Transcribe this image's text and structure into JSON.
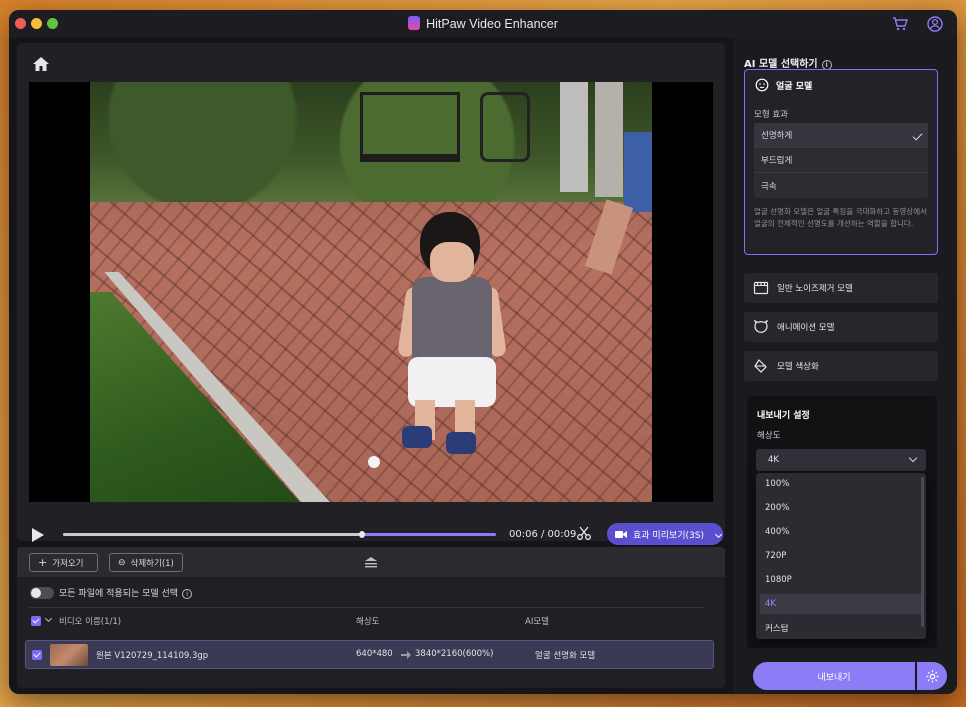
{
  "app": {
    "title": "HitPaw Video Enhancer"
  },
  "player": {
    "timecode": "00:06 / 00:09",
    "progress_fraction": 0.69,
    "preview_label": "효과 미리보기(3S)"
  },
  "files_panel": {
    "import_label": "가져오기",
    "delete_label": "삭제하기(1)",
    "apply_all_label": "모든 파일에 적용되는 모델 선택",
    "columns": {
      "name": "비디오 이름(1/1)",
      "resolution": "해상도",
      "ai_model": "AI모델"
    },
    "rows": [
      {
        "name": "원본 V120729_114109.3gp",
        "resolution": "640*480",
        "target_resolution": "3840*2160(600%)",
        "model": "얼굴 선명화 모델"
      }
    ]
  },
  "sidebar": {
    "title": "AI 모델 선택하기",
    "face_model": {
      "name": "얼굴 모델",
      "effect_label": "모형 효과",
      "options": [
        "선명하게",
        "부드럽게",
        "극속"
      ],
      "selected": "선명하게",
      "description": "얼굴 선명화 모델은 얼굴 특징을 극대화하고 동영상에서 얼굴의 전체적인 선명도를 개선하는 역할을 합니다."
    },
    "models": [
      {
        "name": "일반 노이즈제거 모델",
        "icon": "film-icon"
      },
      {
        "name": "애니메이션 모델",
        "icon": "animation-face-icon"
      },
      {
        "name": "모델 색상화",
        "icon": "paint-bucket-icon"
      }
    ],
    "export": {
      "title": "내보내기 설정",
      "resolution_label": "해상도",
      "selected": "4K",
      "options": [
        "100%",
        "200%",
        "400%",
        "720P",
        "1080P",
        "4K",
        "커스텀"
      ],
      "button_label": "내보내기"
    }
  },
  "colors": {
    "accent": "#8c7df7",
    "panel_bg": "#1a1a1f",
    "selected_border": "#8070f4"
  }
}
